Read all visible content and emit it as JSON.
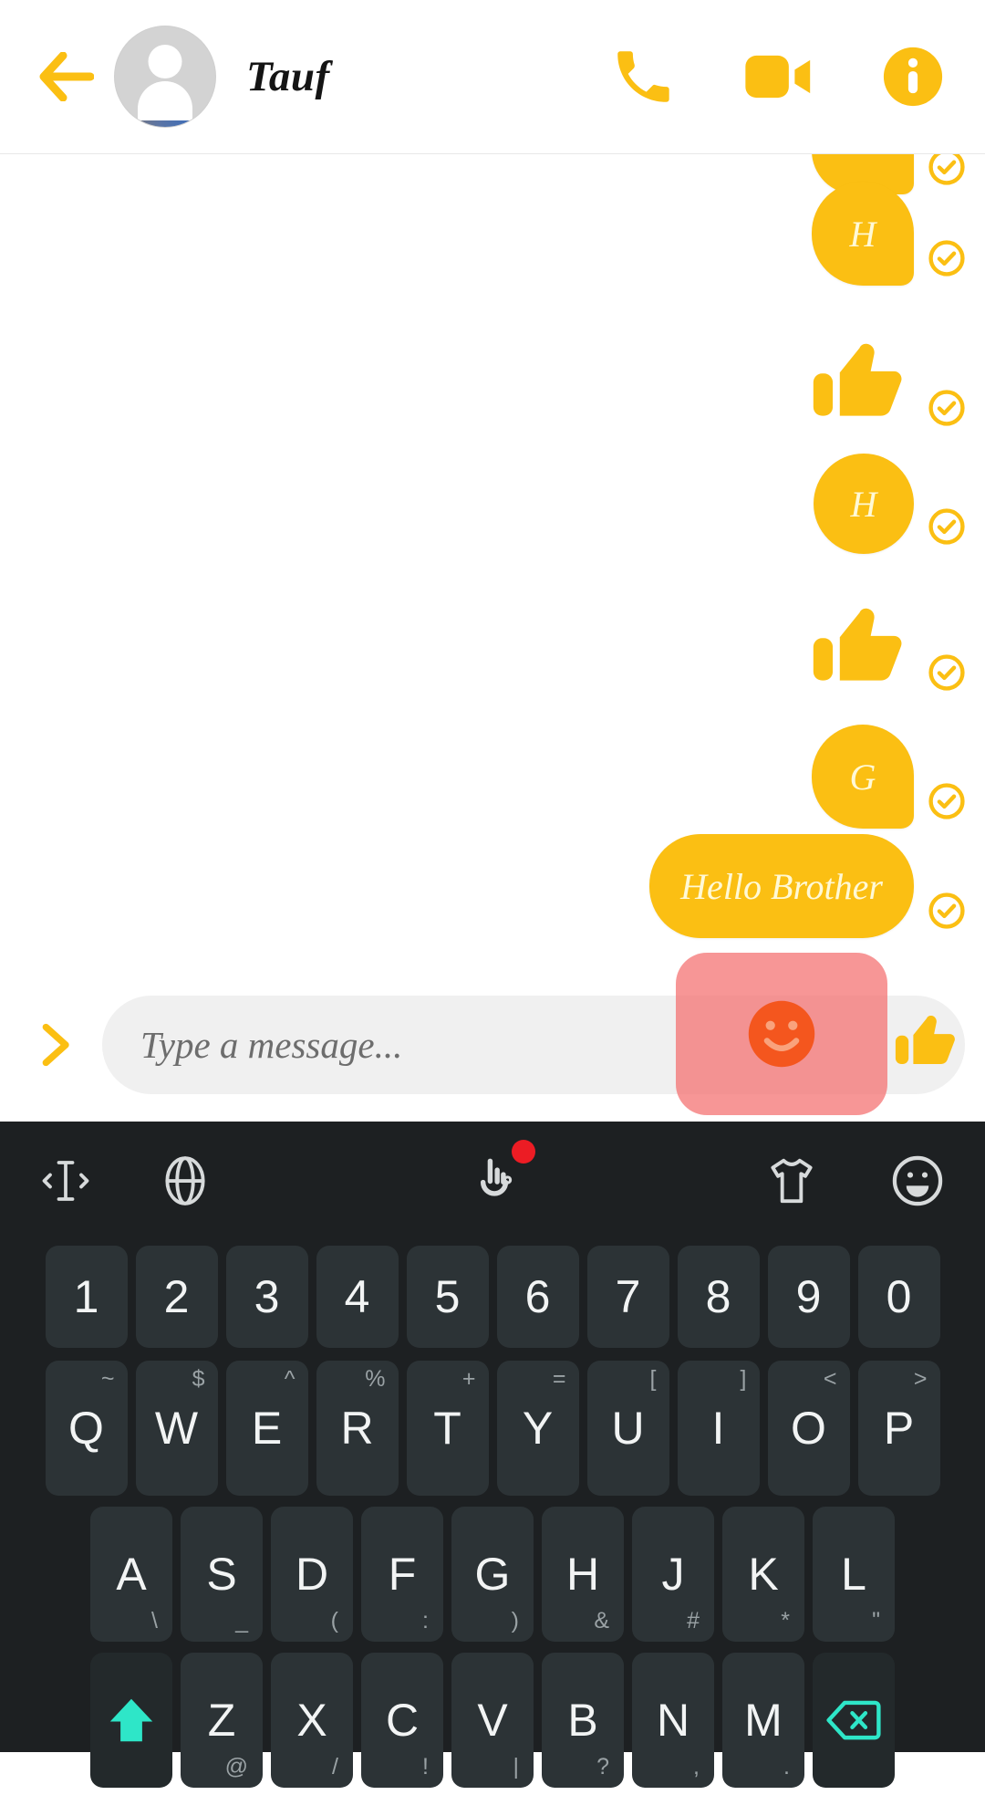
{
  "header": {
    "back_icon": "arrow-left-icon",
    "avatar_alt": "contact-avatar",
    "contact_name": "Tauf",
    "actions": [
      {
        "icon": "phone-call-icon",
        "label": "Voice call"
      },
      {
        "icon": "video-camera-icon",
        "label": "Video call"
      },
      {
        "icon": "info-circle-icon",
        "label": "Conversation info"
      }
    ]
  },
  "theme": {
    "accent": "#FBBF13",
    "bubble_text": "#FFF9D6",
    "highlight": "#F46E6E",
    "emoji_orange": "#F4561E",
    "keyboard_bg": "#1D2022",
    "key_bg": "#2C3336",
    "key_text": "#F2F4F4",
    "key_secondary": "#9AA2A5",
    "mod_key_accent": "#2EE6C8",
    "badge_red": "#EC1C24"
  },
  "chat": {
    "messages": [
      {
        "type": "text",
        "text": "",
        "sender": "me",
        "status": "delivered",
        "clipped": true
      },
      {
        "type": "text",
        "text": "H",
        "sender": "me",
        "status": "delivered"
      },
      {
        "type": "sticker",
        "sticker": "thumbs-up",
        "sender": "me",
        "status": "delivered"
      },
      {
        "type": "text",
        "text": "H",
        "sender": "me",
        "status": "delivered"
      },
      {
        "type": "sticker",
        "sticker": "thumbs-up",
        "sender": "me",
        "status": "delivered"
      },
      {
        "type": "text",
        "text": "G",
        "sender": "me",
        "status": "delivered"
      },
      {
        "type": "text",
        "text": "Hello Brother",
        "sender": "me",
        "status": "delivered"
      }
    ],
    "status_icon": "check-circle-icon"
  },
  "input_bar": {
    "expand_icon": "chevron-right-icon",
    "placeholder": "Type a message...",
    "value": "",
    "emoji_button": {
      "icon": "smiley-face-icon",
      "highlighted": true
    },
    "like_button": {
      "icon": "thumbs-up-icon"
    }
  },
  "keyboard": {
    "toolbar": {
      "left": [
        {
          "icon": "text-cursor-icon",
          "name": "cursor-control"
        },
        {
          "icon": "globe-icon",
          "name": "language-switch"
        }
      ],
      "center": [
        {
          "icon": "hand-gesture-icon",
          "name": "gesture-typing",
          "badge": true
        }
      ],
      "right": [
        {
          "icon": "tshirt-icon",
          "name": "theme-sticker"
        },
        {
          "icon": "emoji-face-icon",
          "name": "emoji-panel"
        }
      ]
    },
    "rows": {
      "numbers": [
        {
          "main": "1"
        },
        {
          "main": "2"
        },
        {
          "main": "3"
        },
        {
          "main": "4"
        },
        {
          "main": "5"
        },
        {
          "main": "6"
        },
        {
          "main": "7"
        },
        {
          "main": "8"
        },
        {
          "main": "9"
        },
        {
          "main": "0"
        }
      ],
      "top": [
        {
          "main": "Q",
          "sec": "~"
        },
        {
          "main": "W",
          "sec": "$"
        },
        {
          "main": "E",
          "sec": "^"
        },
        {
          "main": "R",
          "sec": "%"
        },
        {
          "main": "T",
          "sec": "+"
        },
        {
          "main": "Y",
          "sec": "="
        },
        {
          "main": "U",
          "sec": "["
        },
        {
          "main": "I",
          "sec": "]"
        },
        {
          "main": "O",
          "sec": "<"
        },
        {
          "main": "P",
          "sec": ">"
        }
      ],
      "home": [
        {
          "main": "A",
          "sec": "\\"
        },
        {
          "main": "S",
          "sec": "_"
        },
        {
          "main": "D",
          "sec": "("
        },
        {
          "main": "F",
          "sec": ":"
        },
        {
          "main": "G",
          "sec": ")"
        },
        {
          "main": "H",
          "sec": "&"
        },
        {
          "main": "J",
          "sec": "#"
        },
        {
          "main": "K",
          "sec": "*"
        },
        {
          "main": "L",
          "sec": "\""
        }
      ],
      "bottom": [
        {
          "main": "Z",
          "sec": "@"
        },
        {
          "main": "X",
          "sec": "/"
        },
        {
          "main": "C",
          "sec": "!"
        },
        {
          "main": "V",
          "sec": "|"
        },
        {
          "main": "B",
          "sec": "?"
        },
        {
          "main": "N",
          "sec": ","
        },
        {
          "main": "M",
          "sec": "."
        }
      ],
      "shift_icon": "shift-arrow-icon",
      "backspace_icon": "backspace-icon"
    }
  }
}
